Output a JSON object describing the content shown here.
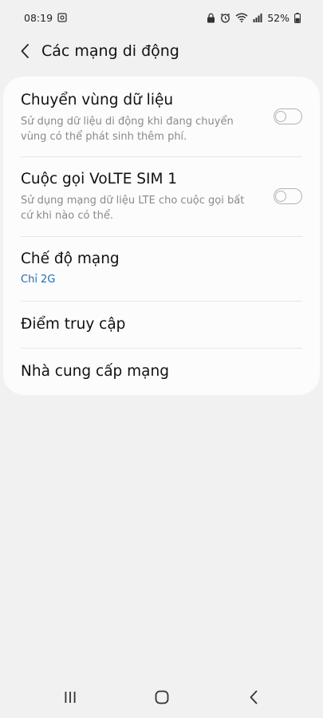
{
  "status_bar": {
    "time": "08:19",
    "battery": "52%",
    "icons": [
      "screenshot-icon",
      "lock-icon",
      "alarm-icon",
      "wifi-icon",
      "signal-icon",
      "battery-icon"
    ]
  },
  "header": {
    "title": "Các mạng di động",
    "back_icon": "chevron-left-icon"
  },
  "settings": {
    "roaming": {
      "title": "Chuyển vùng dữ liệu",
      "subtitle": "Sử dụng dữ liệu di động khi đang chuyển vùng có thể phát sinh thêm phí.",
      "enabled": false
    },
    "volte": {
      "title": "Cuộc gọi VoLTE SIM 1",
      "subtitle": "Sử dụng mạng dữ liệu LTE cho cuộc gọi bất cứ khi nào có thể.",
      "enabled": false
    },
    "network_mode": {
      "title": "Chế độ mạng",
      "value": "Chỉ 2G"
    },
    "access_points": {
      "title": "Điểm truy cập"
    },
    "operators": {
      "title": "Nhà cung cấp mạng"
    }
  },
  "colors": {
    "background": "#f1f1f1",
    "card": "#fcfcfc",
    "accent": "#1b6fb8",
    "secondary_text": "#8a8a8a"
  },
  "nav_bar": {
    "icons": [
      "recent-apps-icon",
      "home-icon",
      "back-icon"
    ]
  }
}
